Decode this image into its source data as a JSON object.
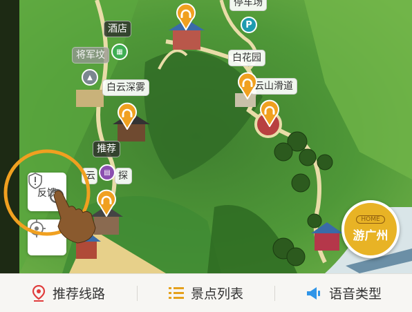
{
  "map": {
    "labels": {
      "parking": "停车场",
      "hotel": "酒店",
      "general_tomb": "将军坟",
      "baiyun_mist": "白云深雾",
      "baihua_garden": "白花园",
      "baiyun_slide": "云山滑道",
      "recommend": "推荐",
      "explore_left": "云",
      "explore_right": "探"
    },
    "parking_icon_text": "P",
    "badge": {
      "home_text": "HOME",
      "title": "游广州"
    }
  },
  "side": {
    "feedback_label": "反馈"
  },
  "tabbar": {
    "tabs": [
      {
        "label": "推荐线路",
        "icon": "route-pin-icon",
        "color": "#e03c3c"
      },
      {
        "label": "景点列表",
        "icon": "list-icon",
        "color": "#e5a11c"
      },
      {
        "label": "语音类型",
        "icon": "speaker-icon",
        "color": "#2f95e8"
      }
    ]
  },
  "colors": {
    "accent_orange": "#f0a020",
    "tab_text": "#333333"
  }
}
